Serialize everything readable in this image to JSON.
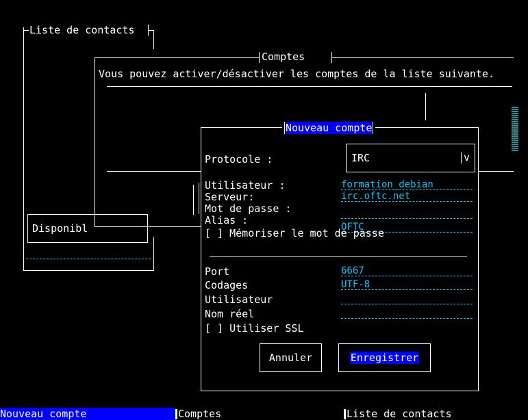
{
  "contacts_window": {
    "title": "Liste de contacts",
    "status_value": "Disponibl"
  },
  "accounts_window": {
    "title": "Comptes",
    "description": "Vous pouvez activer/désactiver les comptes de la liste suivante."
  },
  "new_account_dialog": {
    "title": "Nouveau compte",
    "protocol_label": "Protocole :",
    "protocol_value": "IRC",
    "protocol_dropdown_glyph": "v",
    "username_label": "Utilisateur :",
    "username_value": "formation_debian",
    "server_label": "Serveur:",
    "server_value": "irc.oftc.net",
    "password_label": "Mot de passe :",
    "password_value": "",
    "alias_label": "Alias :",
    "alias_value": "OFTC",
    "remember_password": "[ ] Mémoriser le mot de passe",
    "port_label": "Port",
    "port_value": "6667",
    "encodings_label": "Codages",
    "encodings_value": "UTF-8",
    "irc_user_label": "Utilisateur",
    "irc_user_value": "",
    "real_name_label": "Nom réel",
    "real_name_value": "",
    "use_ssl": "[ ] Utiliser SSL",
    "cancel_button": "Annuler",
    "save_button": "Enregistrer"
  },
  "taskbar": {
    "items": [
      "Nouveau compte",
      "Comptes",
      "Liste de contacts"
    ]
  },
  "colors": {
    "background": "#000000",
    "text": "#ffffff",
    "field": "#00c8ff",
    "selection": "#0000ff",
    "scrollbar": "#2f8f8f"
  }
}
